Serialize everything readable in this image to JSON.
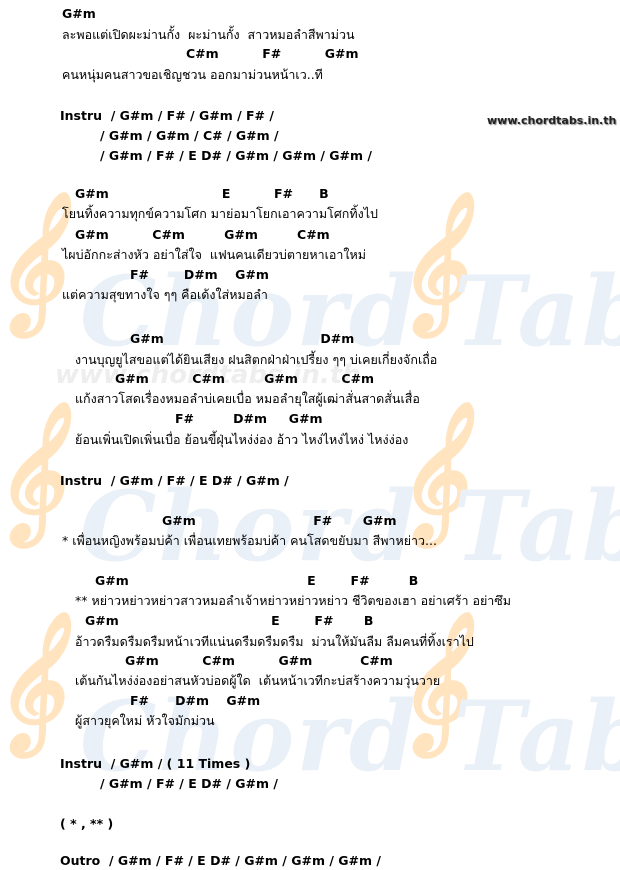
{
  "site_label": "www.chordtabs.in.th",
  "watermark": {
    "text": "Chord Tabs",
    "url": "www.chordtabs.in.th"
  },
  "lines": [
    {
      "t": "chord",
      "s": "G#m"
    },
    {
      "t": "lyric",
      "s": "ละพอแต่เปิดผะม่านกั้ง  ผะม่านกั้ง  สาวหมอลำสีพาม่วน"
    },
    {
      "t": "chord",
      "s": "C#m          F#          G#m"
    },
    {
      "t": "lyric",
      "s": "คนหนุ่มคนสาวขอเชิญชวน ออกมาม่วนหน้าเว..ที"
    },
    {
      "t": "chord",
      "s": "Instru  / G#m / F# / G#m / F# /"
    },
    {
      "t": "chord",
      "s": "/ G#m / G#m / C# / G#m /"
    },
    {
      "t": "chord",
      "s": "/ G#m / F# / E D# / G#m / G#m / G#m /"
    },
    {
      "t": "chord",
      "s": "G#m                          E          F#      B"
    },
    {
      "t": "lyric",
      "s": "โยนทิ้งความทุกข์ความโศก มาย่อมาโยกเอาความโศกทิ้งไป"
    },
    {
      "t": "chord",
      "s": "G#m          C#m         G#m         C#m"
    },
    {
      "t": "lyric",
      "s": "ไผบ่อักกะส่างหัว อย่าใส่ใจ  แฟนคนเดียวบ่ตายหาเอาใหม่"
    },
    {
      "t": "chord",
      "s": "F#        D#m    G#m"
    },
    {
      "t": "lyric",
      "s": "แต่ความสุขทางใจ ๆๆ คือเด้งใส่หมอลำ"
    },
    {
      "t": "chord",
      "s": "G#m                                    D#m"
    },
    {
      "t": "lyric",
      "s": "งานบุญยูไสขอแต่ได้ยินเสียง ฝนสิตกฝ่าฝ่าเปรี้ยง ๆๆ บ่เคยเกี่ยงจักเถื่อ"
    },
    {
      "t": "chord",
      "s": "G#m          C#m         G#m          C#m"
    },
    {
      "t": "lyric",
      "s": "แก้งสาวโสดเรื่องหมอลำบ่เคยเบื่อ หมอลำยุใสผู้เฒ่าสั่นสาดสั่นเสื่อ"
    },
    {
      "t": "chord",
      "s": "F#         D#m     G#m"
    },
    {
      "t": "lyric",
      "s": "ย้อนเพิ่นเปิดเพิ่นเบื่อ ย้อนขี้ฝุ่นไหง่ง่อง อ้าว ไหง่ไหง่ไหง่ ไหง่ง่อง"
    },
    {
      "t": "chord",
      "s": "Instru  / G#m / F# / E D# / G#m /"
    },
    {
      "t": "chord",
      "s": "G#m                           F#       G#m"
    },
    {
      "t": "lyric",
      "s": "* เพื่อนหญิงพร้อมบ่ค้า เพื่อนเทยพร้อมบ่ค้า คนโสดขยับมา สีพาหย่าว..."
    },
    {
      "t": "chord",
      "s": "G#m                                         E        F#         B"
    },
    {
      "t": "lyric",
      "s": "** หย่าวหย่าวหย่าวสาวหมอลำเจ้าหย่าวหย่าวหย่าว ชีวิตของเฮา อย่าเศร้า อย่าซึม"
    },
    {
      "t": "chord",
      "s": "G#m                                   E        F#       B"
    },
    {
      "t": "lyric",
      "s": "อ้าวดรืมดรืมดรืมหน้าเวทีแน่นดรืมดรืมดรืม  ม่วนให้มันลืม ลืมคนที่ทิ้งเราไป"
    },
    {
      "t": "chord",
      "s": "G#m          C#m          G#m           C#m"
    },
    {
      "t": "lyric",
      "s": "เต้นกันไหง่ง่องอย่าสนหัวบ่อดผู้ใด  เต้นหน้าเวทีกะบ่สร้างความวุ่นวาย"
    },
    {
      "t": "chord",
      "s": "F#      D#m    G#m"
    },
    {
      "t": "lyric",
      "s": "ผู้สาวยุคใหม่ หัวใจมักม่วน"
    },
    {
      "t": "chord",
      "s": "Instru  / G#m / ( 11 Times )"
    },
    {
      "t": "chord",
      "s": "/ G#m / F# / E D# / G#m /"
    },
    {
      "t": "chord",
      "s": "( * , ** )"
    },
    {
      "t": "chord",
      "s": "Outro  / G#m / F# / E D# / G#m / G#m / G#m /"
    }
  ]
}
